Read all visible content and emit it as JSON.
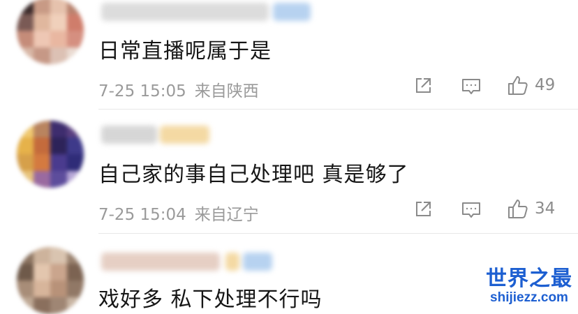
{
  "comments": [
    {
      "text": "日常直播呢属于是",
      "time": "7-25 15:05",
      "location": "来自陕西",
      "likes": "49",
      "icons": [
        "share-icon",
        "comment-icon",
        "thumbs-up-icon"
      ]
    },
    {
      "text": "自己家的事自己处理吧 真是够了",
      "time": "7-25 15:04",
      "location": "来自辽宁",
      "likes": "34",
      "icons": [
        "share-icon",
        "comment-icon",
        "thumbs-up-icon"
      ]
    },
    {
      "text": "戏好多 私下处理不行吗"
    }
  ],
  "colors": {
    "meta_text": "#9a9a9a",
    "watermark": "#1d5fd1"
  },
  "watermark": {
    "title": "世界之最",
    "url": "shijiezz.com"
  }
}
